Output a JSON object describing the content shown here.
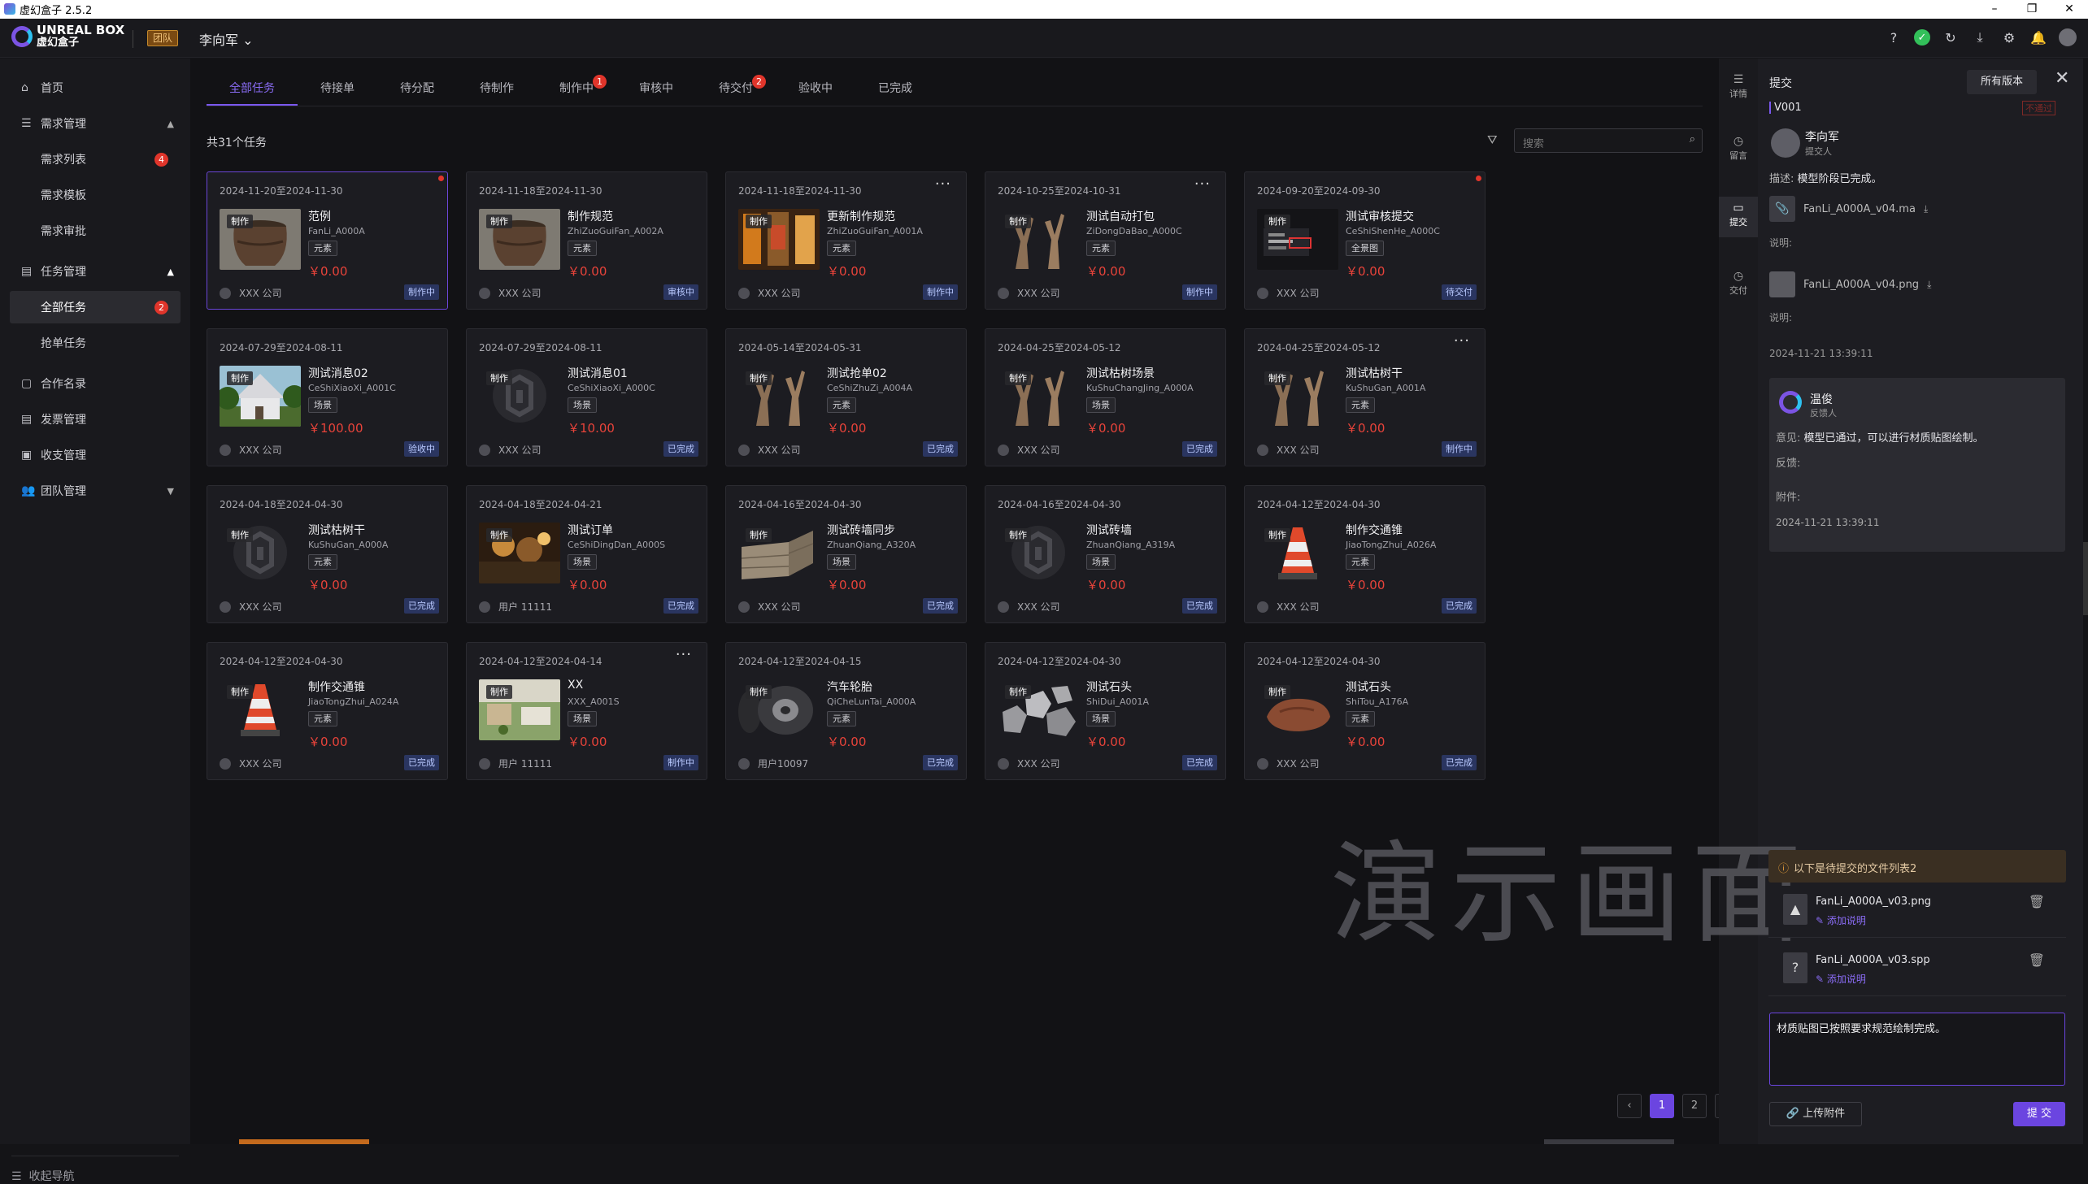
{
  "window": {
    "title": "虚幻盒子 2.5.2"
  },
  "header": {
    "logo_en": "UNREAL BOX",
    "logo_cn": "虚幻盒子",
    "team_badge": "团队",
    "user": "李向军"
  },
  "sidebar": {
    "home": "首页",
    "demand": "需求管理",
    "demand_list": "需求列表",
    "demand_list_count": "4",
    "demand_template": "需求模板",
    "demand_approval": "需求审批",
    "task": "任务管理",
    "all_tasks": "全部任务",
    "all_tasks_count": "2",
    "grab_tasks": "抢单任务",
    "contracts": "合作名录",
    "invoices": "发票管理",
    "payments": "收支管理",
    "team": "团队管理",
    "collapse": "收起导航"
  },
  "tabs": [
    {
      "label": "全部任务"
    },
    {
      "label": "待接单"
    },
    {
      "label": "待分配"
    },
    {
      "label": "待制作"
    },
    {
      "label": "制作中",
      "badge": "1"
    },
    {
      "label": "审核中"
    },
    {
      "label": "待交付",
      "badge": "2"
    },
    {
      "label": "验收中"
    },
    {
      "label": "已完成"
    }
  ],
  "toolbar": {
    "total": "共31个任务",
    "search_placeholder": "搜索"
  },
  "cards": [
    {
      "date": "2024-11-20至2024-11-30",
      "tag": "制作",
      "name": "范例",
      "code": "FanLi_A000A",
      "type": "元素",
      "price": "￥0.00",
      "owner": "XXX 公司",
      "status": "制作中",
      "thumb": "pot"
    },
    {
      "date": "2024-11-18至2024-11-30",
      "tag": "制作",
      "name": "制作规范",
      "code": "ZhiZuoGuiFan_A002A",
      "type": "元素",
      "price": "￥0.00",
      "owner": "XXX 公司",
      "status": "审核中",
      "thumb": "pot"
    },
    {
      "date": "2024-11-18至2024-11-30",
      "tag": "制作",
      "name": "更新制作规范",
      "code": "ZhiZuoGuiFan_A001A",
      "type": "元素",
      "price": "￥0.00",
      "owner": "XXX 公司",
      "status": "制作中",
      "thumb": "shelf"
    },
    {
      "date": "2024-10-25至2024-10-31",
      "tag": "制作",
      "name": "测试自动打包",
      "code": "ZiDongDaBao_A000C",
      "type": "元素",
      "price": "￥0.00",
      "owner": "XXX 公司",
      "status": "制作中",
      "thumb": "tree"
    },
    {
      "date": "2024-09-20至2024-09-30",
      "tag": "制作",
      "name": "测试审核提交",
      "code": "CeShiShenHe_A000C",
      "type": "全景图",
      "price": "￥0.00",
      "owner": "XXX 公司",
      "status": "待交付",
      "thumb": "dark"
    },
    {
      "date": "2024-07-29至2024-08-11",
      "tag": "制作",
      "name": "测试消息02",
      "code": "CeShiXiaoXi_A001C",
      "type": "场景",
      "price": "￥100.00",
      "owner": "XXX 公司",
      "status": "验收中",
      "thumb": "house"
    },
    {
      "date": "2024-07-29至2024-08-11",
      "tag": "制作",
      "name": "测试消息01",
      "code": "CeShiXiaoXi_A000C",
      "type": "场景",
      "price": "￥10.00",
      "owner": "XXX 公司",
      "status": "已完成",
      "thumb": "logo"
    },
    {
      "date": "2024-05-14至2024-05-31",
      "tag": "制作",
      "name": "测试抢单02",
      "code": "CeShiZhuZi_A004A",
      "type": "元素",
      "price": "￥0.00",
      "owner": "XXX 公司",
      "status": "已完成",
      "thumb": "tree"
    },
    {
      "date": "2024-04-25至2024-05-12",
      "tag": "制作",
      "name": "测试枯树场景",
      "code": "KuShuChangJing_A000A",
      "type": "场景",
      "price": "￥0.00",
      "owner": "XXX 公司",
      "status": "已完成",
      "thumb": "tree"
    },
    {
      "date": "2024-04-25至2024-05-12",
      "tag": "制作",
      "name": "测试枯树干",
      "code": "KuShuGan_A001A",
      "type": "元素",
      "price": "￥0.00",
      "owner": "XXX 公司",
      "status": "制作中",
      "thumb": "tree"
    },
    {
      "date": "2024-04-18至2024-04-30",
      "tag": "制作",
      "name": "测试枯树干",
      "code": "KuShuGan_A000A",
      "type": "元素",
      "price": "￥0.00",
      "owner": "XXX 公司",
      "status": "已完成",
      "thumb": "logo"
    },
    {
      "date": "2024-04-18至2024-04-21",
      "tag": "制作",
      "name": "测试订单",
      "code": "CeShiDingDan_A000S",
      "type": "场景",
      "price": "￥0.00",
      "owner": "用户 11111",
      "status": "已完成",
      "thumb": "crowd"
    },
    {
      "date": "2024-04-16至2024-04-30",
      "tag": "制作",
      "name": "测试砖墙同步",
      "code": "ZhuanQiang_A320A",
      "type": "场景",
      "price": "￥0.00",
      "owner": "XXX 公司",
      "status": "已完成",
      "thumb": "wall"
    },
    {
      "date": "2024-04-16至2024-04-30",
      "tag": "制作",
      "name": "测试砖墙",
      "code": "ZhuanQiang_A319A",
      "type": "场景",
      "price": "￥0.00",
      "owner": "XXX 公司",
      "status": "已完成",
      "thumb": "logo"
    },
    {
      "date": "2024-04-12至2024-04-30",
      "tag": "制作",
      "name": "制作交通锥",
      "code": "JiaoTongZhui_A026A",
      "type": "元素",
      "price": "￥0.00",
      "owner": "XXX 公司",
      "status": "已完成",
      "thumb": "cone"
    },
    {
      "date": "2024-04-12至2024-04-30",
      "tag": "制作",
      "name": "制作交通锥",
      "code": "JiaoTongZhui_A024A",
      "type": "元素",
      "price": "￥0.00",
      "owner": "XXX 公司",
      "status": "已完成",
      "thumb": "cone"
    },
    {
      "date": "2024-04-12至2024-04-14",
      "tag": "制作",
      "name": "XX",
      "code": "XXX_A001S",
      "type": "场景",
      "price": "￥0.00",
      "owner": "用户 11111",
      "status": "制作中",
      "thumb": "scene"
    },
    {
      "date": "2024-04-12至2024-04-15",
      "tag": "制作",
      "name": "汽车轮胎",
      "code": "QiCheLunTai_A000A",
      "type": "元素",
      "price": "￥0.00",
      "owner": "用户10097",
      "status": "已完成",
      "thumb": "tire"
    },
    {
      "date": "2024-04-12至2024-04-30",
      "tag": "制作",
      "name": "测试石头",
      "code": "ShiDui_A001A",
      "type": "场景",
      "price": "￥0.00",
      "owner": "XXX 公司",
      "status": "已完成",
      "thumb": "rocks"
    },
    {
      "date": "2024-04-12至2024-04-30",
      "tag": "制作",
      "name": "测试石头",
      "code": "ShiTou_A176A",
      "type": "元素",
      "price": "￥0.00",
      "owner": "XXX 公司",
      "status": "已完成",
      "thumb": "rock"
    }
  ],
  "pagination": {
    "pages": [
      "1",
      "2"
    ],
    "current": "1",
    "prev": "‹",
    "next": "›"
  },
  "rail": {
    "detail": "详情",
    "message": "留言",
    "submit": "提交",
    "deliver": "交付"
  },
  "panel": {
    "title": "提交",
    "all_versions": "所有版本",
    "version": "V001",
    "reject": "不通过",
    "submitter_name": "李向军",
    "submitter_role": "提交人",
    "desc_label": "描述:",
    "desc_value": "模型阶段已完成。",
    "file1": "FanLi_A000A_v04.ma",
    "file2": "FanLi_A000A_v04.png",
    "note_label": "说明:",
    "timestamp": "2024-11-21 13:39:11",
    "feedback": {
      "name": "温俊",
      "role": "反馈人",
      "opinion_label": "意见:",
      "opinion": "模型已通过，可以进行材质贴图绘制。",
      "fb_label": "反馈:",
      "attach_label": "附件:",
      "time": "2024-11-21 13:39:11"
    },
    "watermark": "演示画面",
    "pending_title": "以下是待提交的文件列表2",
    "pending_files": [
      {
        "name": "FanLi_A000A_v03.png",
        "add": "添加说明"
      },
      {
        "name": "FanLi_A000A_v03.spp",
        "add": "添加说明"
      }
    ],
    "comment": "材质贴图已按照要求规范绘制完成。",
    "upload": "上传附件",
    "submit": "提 交"
  }
}
